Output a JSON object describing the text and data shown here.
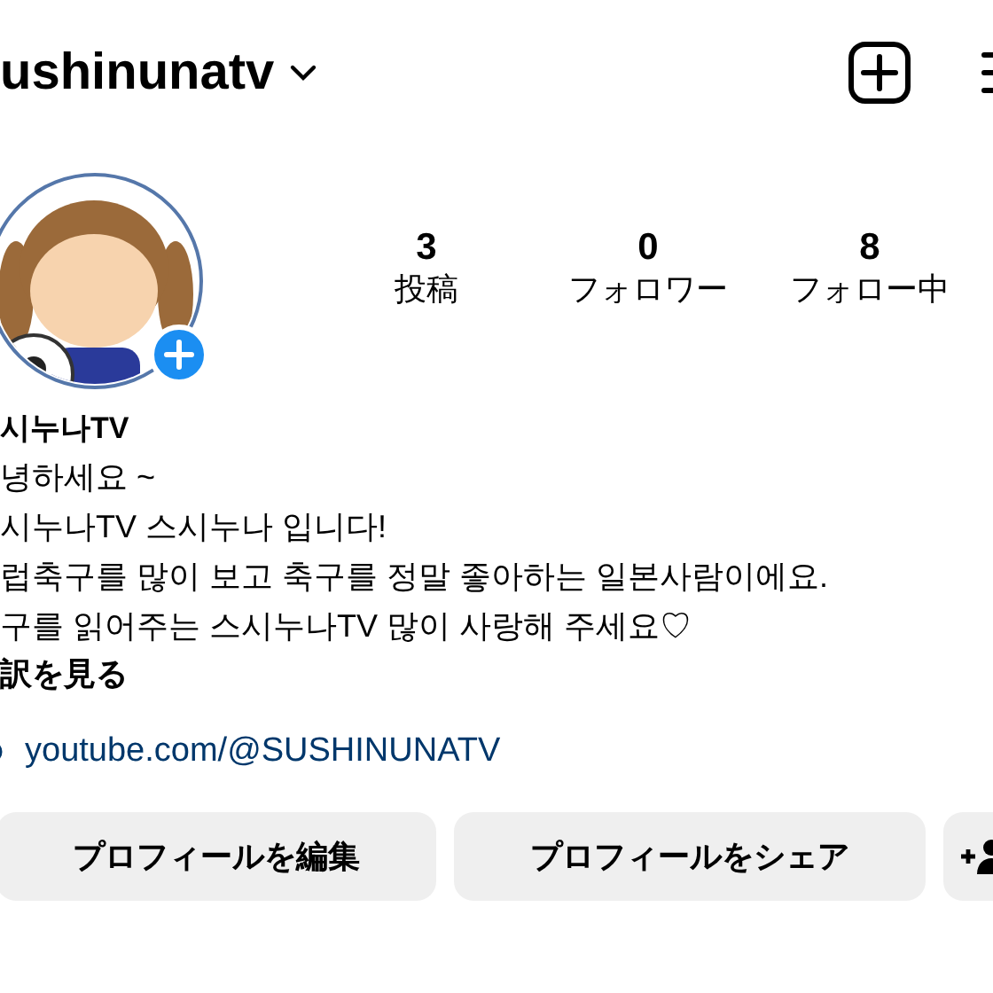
{
  "header": {
    "username": "ushinunatv"
  },
  "avatar": {
    "kind": "picture",
    "add_badge": true
  },
  "stats": [
    {
      "value": "3",
      "label": "投稿"
    },
    {
      "value": "0",
      "label": "フォロワー"
    },
    {
      "value": "8",
      "label": "フォロー中"
    }
  ],
  "profile": {
    "name": "시누나TV",
    "bio": [
      "녕하세요 ~",
      "시누나TV 스시누나 입니다!",
      "럽축구를 많이 보고 축구를 정말 좋아하는 일본사람이에요.",
      "구를 읽어주는 스시누나TV 많이 사랑해 주세요♡"
    ],
    "translate": "訳を見る",
    "link": "youtube.com/@SUSHINUNATV"
  },
  "buttons": [
    {
      "kind": "text",
      "label": "プロフィールを編集"
    },
    {
      "kind": "text",
      "label": "プロフィールをシェア"
    },
    {
      "kind": "icon"
    }
  ]
}
